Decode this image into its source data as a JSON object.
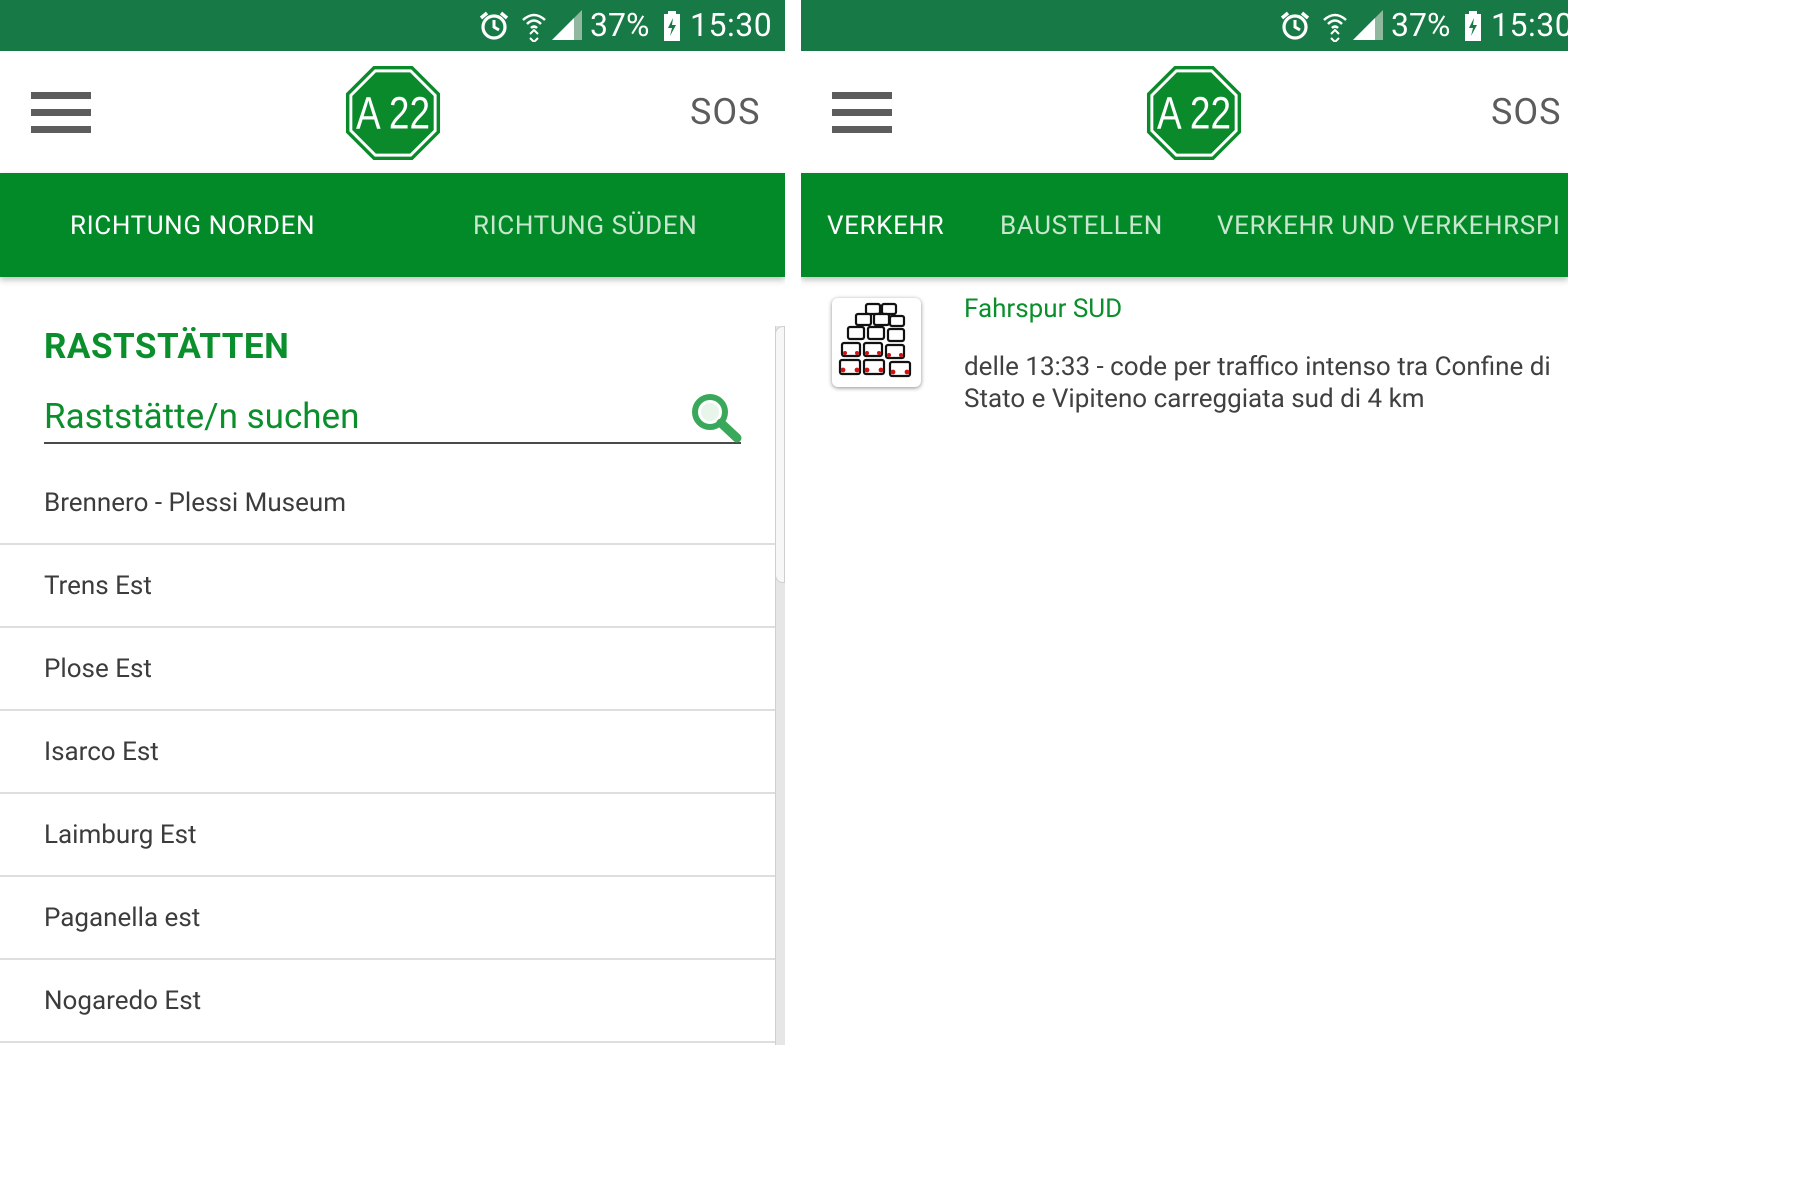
{
  "status_bar": {
    "battery_percent": "37%",
    "time": "15:30",
    "icons": [
      "alarm-icon",
      "wifi-icon",
      "signal-icon",
      "battery-charging-icon"
    ]
  },
  "app": {
    "logo_text": "A 22",
    "sos_label": "SOS",
    "brand_green": "#018a27",
    "status_green": "#177a46"
  },
  "left_screen": {
    "tabs": [
      {
        "label": "RICHTUNG NORDEN",
        "active": true
      },
      {
        "label": "RICHTUNG SÜDEN",
        "active": false
      }
    ],
    "section_title": "RASTSTÄTTEN",
    "search": {
      "placeholder": "Raststätte/n suchen",
      "value": ""
    },
    "items": [
      "Brennero - Plessi Museum",
      "Trens Est",
      "Plose Est",
      "Isarco Est",
      "Laimburg Est",
      "Paganella est",
      "Nogaredo Est"
    ]
  },
  "right_screen": {
    "tabs": [
      {
        "label": "VERKEHR",
        "active": true
      },
      {
        "label": "BAUSTELLEN",
        "active": false
      },
      {
        "label": "VERKEHR UND VERKEHRSPI",
        "active": false
      }
    ],
    "traffic_item": {
      "icon": "traffic-jam-icon",
      "title": "Fahrspur SUD",
      "description": "delle 13:33 - code per traffico intenso tra Confine di Stato e Vipiteno carreggiata sud di 4 km"
    }
  }
}
